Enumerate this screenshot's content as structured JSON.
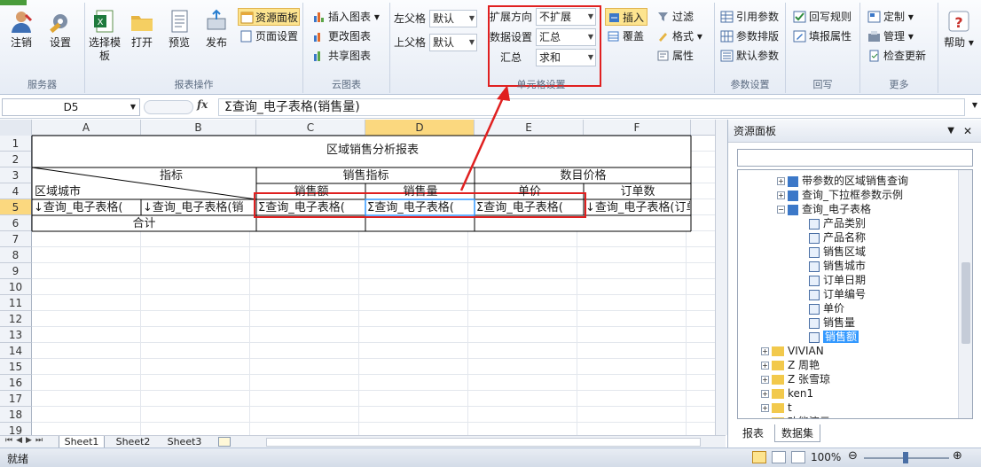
{
  "ribbon": {
    "groups": {
      "server": "服务器",
      "report": "报表操作",
      "cloud": "云图表",
      "cell": "单元格设置",
      "param": "参数设置",
      "writeback": "回写",
      "more": "更多"
    },
    "logout": "注销",
    "settings": "设置",
    "select_template": "选择模板",
    "open": "打开",
    "preview": "预览",
    "publish": "发布",
    "resource_panel": "资源面板",
    "page_setup": "页面设置",
    "insert_chart": "插入图表",
    "change_chart": "更改图表",
    "share_chart": "共享图表",
    "left_parent": "左父格",
    "left_parent_value": "默认",
    "top_parent": "上父格",
    "top_parent_value": "默认",
    "expand_dir": "扩展方向",
    "expand_dir_value": "不扩展",
    "data_setting": "数据设置",
    "data_setting_value": "汇总",
    "summary": "汇总",
    "summary_value": "求和",
    "insert": "插入",
    "overwrite": "覆盖",
    "filter": "过滤",
    "format": "格式",
    "property": "属性",
    "ref_param": "引用参数",
    "param_layout": "参数排版",
    "default_param": "默认参数",
    "writeback_rule": "回写规则",
    "fill_prop": "填报属性",
    "custom": "定制",
    "manage": "管理",
    "check_update": "检查更新",
    "help": "帮助"
  },
  "formula_bar": {
    "cell_ref": "D5",
    "fx": "fx",
    "content": "Σ查询_电子表格(销售量)"
  },
  "sheet": {
    "columns": [
      "A",
      "B",
      "C",
      "D",
      "E",
      "F"
    ],
    "rows": [
      "1",
      "2",
      "3",
      "4",
      "5",
      "6",
      "7",
      "8",
      "9",
      "10",
      "11",
      "12",
      "13",
      "14",
      "15",
      "16",
      "17",
      "18",
      "19"
    ],
    "title": "区域销售分析报表",
    "indicator": "指标",
    "region_city": "区域城市",
    "sales_indicator": "销售指标",
    "count_price": "数目价格",
    "sales_amount": "销售额",
    "sales_qty": "销售量",
    "unit_price": "单价",
    "order_count": "订单数",
    "a5": "↓查询_电子表格(",
    "b5": "↓查询_电子表格(销",
    "c5": "Σ查询_电子表格(",
    "d5": "Σ查询_电子表格(",
    "e5": "Σ查询_电子表格(",
    "f5": "↓查询_电子表格(订单",
    "total": "合计",
    "tabs": [
      "Sheet1",
      "Sheet2",
      "Sheet3"
    ]
  },
  "panel": {
    "title": "资源面板",
    "tree": [
      {
        "label": "带参数的区域销售查询",
        "level": 0
      },
      {
        "label": "查询_下拉框参数示例",
        "level": 0
      },
      {
        "label": "查询_电子表格",
        "level": 0
      },
      {
        "label": "产品类别",
        "level": 1
      },
      {
        "label": "产品名称",
        "level": 1
      },
      {
        "label": "销售区域",
        "level": 1
      },
      {
        "label": "销售城市",
        "level": 1
      },
      {
        "label": "订单日期",
        "level": 1
      },
      {
        "label": "订单编号",
        "level": 1
      },
      {
        "label": "单价",
        "level": 1
      },
      {
        "label": "销售量",
        "level": 1
      },
      {
        "label": "销售额",
        "level": 1,
        "selected": true
      },
      {
        "label": "VIVIAN",
        "level": -1
      },
      {
        "label": "Z 周艳",
        "level": -1
      },
      {
        "label": "Z 张雪琼",
        "level": -1
      },
      {
        "label": "ken1",
        "level": -1
      },
      {
        "label": "t",
        "level": -1
      },
      {
        "label": "功能演示",
        "level": -1
      }
    ],
    "tab_report": "报表",
    "tab_dataset": "数据集"
  },
  "status": {
    "ready": "就绪",
    "zoom": "100%"
  },
  "colors": {
    "highlight_red": "#e02020",
    "selected_blue": "#3399ff",
    "header_gold": "#fbd87f"
  }
}
